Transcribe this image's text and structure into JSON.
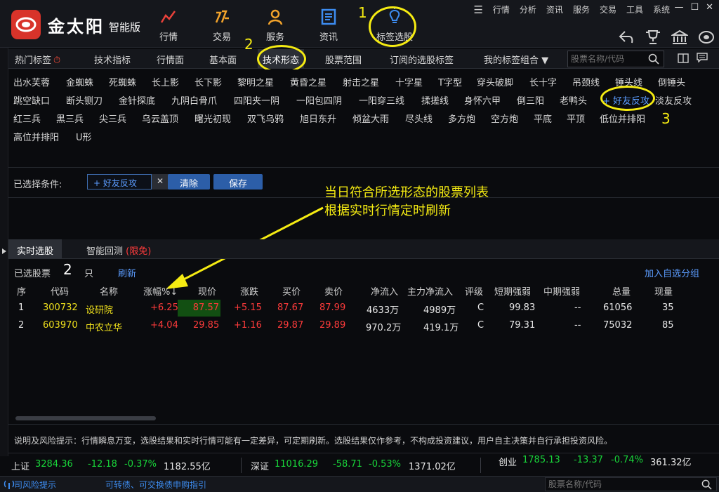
{
  "app": {
    "name": "金太阳",
    "edition": "智能版"
  },
  "nav": [
    {
      "label": "行情",
      "icon": "chart-line-icon"
    },
    {
      "label": "交易",
      "icon": "trade-icon"
    },
    {
      "label": "服务",
      "icon": "user-service-icon"
    },
    {
      "label": "资讯",
      "icon": "news-icon"
    },
    {
      "label": "标签选股",
      "icon": "lightbulb-icon"
    }
  ],
  "window_menu": [
    "行情",
    "分析",
    "资讯",
    "服务",
    "交易",
    "工具",
    "系统"
  ],
  "window_controls": {
    "menu": "☰",
    "minimize": "—",
    "maximize": "☐",
    "close": "✕"
  },
  "annotations": {
    "n1": "1",
    "n2": "2",
    "n3": "3",
    "callout_line1": "当日符合所选形态的股票列表",
    "callout_line2": "根据实时行情定时刷新",
    "selected_count_mark": "2"
  },
  "tabs": [
    "热门标签",
    "技术指标",
    "行情面",
    "基本面",
    "技术形态",
    "股票范围",
    "订阅的选股标签",
    "我的标签组合 ▼"
  ],
  "search": {
    "placeholder": "股票名称/代码"
  },
  "patterns": {
    "row1": [
      "出水芙蓉",
      "金蜘蛛",
      "死蜘蛛",
      "长上影",
      "长下影",
      "黎明之星",
      "黄昏之星",
      "射击之星",
      "十字星",
      "T字型",
      "穿头破脚",
      "长十字",
      "吊颈线",
      "锤头线",
      "倒锤头"
    ],
    "row2": [
      "跳空缺口",
      "断头铡刀",
      "金针探底",
      "九阴白骨爪",
      "四阳夹一阴",
      "一阳包四阴",
      "一阳穿三线",
      "揉搓线",
      "身怀六甲",
      "倒三阳",
      "老鸭头",
      "+ 好友反攻",
      "淡友反攻"
    ],
    "row3": [
      "红三兵",
      "黑三兵",
      "尖三兵",
      "乌云盖顶",
      "曙光初现",
      "双飞乌鸦",
      "旭日东升",
      "倾盆大雨",
      "尽头线",
      "多方炮",
      "空方炮",
      "平底",
      "平顶",
      "低位并排阳"
    ],
    "row4": [
      "高位并排阳",
      "U形"
    ]
  },
  "conditions": {
    "label": "已选择条件:",
    "chip": "+ 好友反攻",
    "chip_remove": "✕",
    "clear": "清除",
    "save": "保存"
  },
  "subtabs": {
    "realtime": "实时选股",
    "backtest": "智能回测",
    "free": "(限免)"
  },
  "result": {
    "prefix": "已选股票",
    "unit": "只",
    "refresh": "刷新",
    "add_group": "加入自选分组"
  },
  "table": {
    "headers": [
      "序",
      "代码",
      "名称",
      "涨幅%↓",
      "现价",
      "涨跌",
      "买价",
      "卖价",
      "净流入",
      "主力净流入",
      "评级",
      "短期强弱",
      "中期强弱",
      "总量",
      "现量"
    ],
    "rows": [
      {
        "seq": "1",
        "code": "300732",
        "name": "设研院",
        "pct": "+6.25",
        "price": "87.57",
        "chg": "+5.15",
        "bid": "87.67",
        "ask": "87.99",
        "inflow": "4633万",
        "main_inflow": "4989万",
        "rating": "C",
        "short": "99.83",
        "mid": "--",
        "vol": "61056",
        "cur": "35"
      },
      {
        "seq": "2",
        "code": "603970",
        "name": "中农立华",
        "pct": "+4.04",
        "price": "29.85",
        "chg": "+1.16",
        "bid": "29.87",
        "ask": "29.89",
        "inflow": "970.2万",
        "main_inflow": "419.1万",
        "rating": "C",
        "short": "79.31",
        "mid": "--",
        "vol": "75032",
        "cur": "85"
      }
    ]
  },
  "disclaimer": "说明及风险提示：行情瞬息万变，选股结果和实时行情可能有一定差异，可定期刷新。选股结果仅作参考，不构成投资建议，用户自主决策并自行承担投资风险。",
  "indices": [
    {
      "name": "上证",
      "value": "3284.36",
      "chg": "-12.18",
      "pct": "-0.37%",
      "amount": "1182.55亿"
    },
    {
      "name": "深证",
      "value": "11016.29",
      "chg": "-58.71",
      "pct": "-0.53%",
      "amount": "1371.02亿"
    },
    {
      "name": "创业",
      "value": "1785.13",
      "chg": "-13.37",
      "pct": "-0.74%",
      "amount": "361.32亿"
    }
  ],
  "status": {
    "risk": "司风险提示",
    "ticker": "可转债、可交换债申购指引",
    "search_placeholder": "股票名称/代码"
  },
  "colors": {
    "up": "#ff3b3b",
    "down": "#19d63a",
    "code": "#f0e11c",
    "accent": "#5b9cff",
    "annotation": "#f5eb12",
    "brand": "#d8332a"
  }
}
